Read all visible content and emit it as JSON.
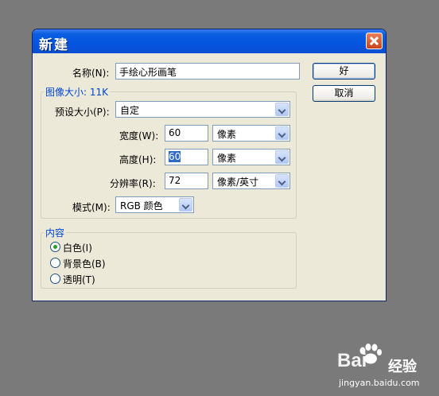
{
  "dialog": {
    "title": "新建",
    "name_label": "名称(N):",
    "name_value": "手绘心形画笔",
    "ok_label": "好",
    "cancel_label": "取消",
    "image_size_title": "图像大小: 11K",
    "preset_label": "预设大小(P):",
    "preset_value": "自定",
    "width_label": "宽度(W):",
    "width_value": "60",
    "width_unit": "像素",
    "height_label": "高度(H):",
    "height_value": "60",
    "height_unit": "像素",
    "resolution_label": "分辨率(R):",
    "resolution_value": "72",
    "resolution_unit": "像素/英寸",
    "mode_label": "模式(M):",
    "mode_value": "RGB 颜色",
    "contents_title": "内容",
    "contents_options": [
      {
        "label": "白色(I)",
        "checked": true
      },
      {
        "label": "背景色(B)",
        "checked": false
      },
      {
        "label": "透明(T)",
        "checked": false
      }
    ]
  },
  "watermark": {
    "brand": "Bai",
    "brand_suffix": "经验",
    "url": "jingyan.baidu.com"
  }
}
